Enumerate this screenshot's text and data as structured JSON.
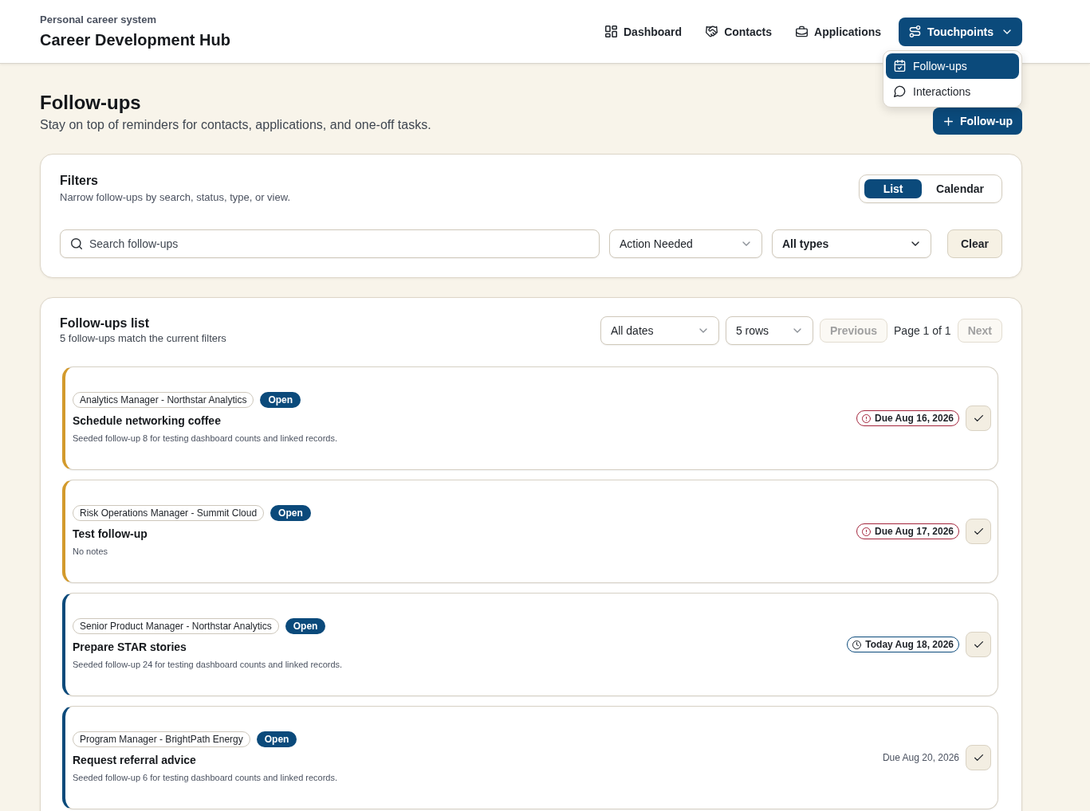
{
  "header": {
    "eyebrow": "Personal career system",
    "title": "Career Development Hub"
  },
  "nav": [
    {
      "label": "Dashboard",
      "kind": "link",
      "selected": false
    },
    {
      "label": "Contacts",
      "kind": "link",
      "selected": false
    },
    {
      "label": "Applications",
      "kind": "link",
      "selected": false
    },
    {
      "label": "Touchpoints",
      "kind": "menu",
      "selected": true,
      "expanded": true,
      "menu": [
        {
          "label": "Follow-ups",
          "selected": true
        },
        {
          "label": "Interactions",
          "selected": false
        }
      ]
    }
  ],
  "page": {
    "title": "Follow-ups",
    "subtitle": "Stay on top of reminders for contacts, applications, and one-off tasks.",
    "add_button": "Follow-up"
  },
  "filters": {
    "title": "Filters",
    "description": "Narrow follow-ups by search, status, type, or view.",
    "view_toggle": [
      {
        "label": "List",
        "selected": true
      },
      {
        "label": "Calendar",
        "selected": false
      }
    ],
    "search": {
      "placeholder": "Search follow-ups"
    },
    "status_select": {
      "value": "Action Needed"
    },
    "type_select": {
      "value": "All types"
    },
    "clear_button": "Clear"
  },
  "list": {
    "title": "Follow-ups list",
    "summary": "5 follow-ups match the current filters",
    "date_select": {
      "value": "All dates"
    },
    "rows_select": {
      "value": "5 rows"
    },
    "pagination": {
      "previous": {
        "label": "Previous",
        "disabled": true
      },
      "page_label": "Page 1 of 1",
      "next": {
        "label": "Next",
        "disabled": true
      }
    },
    "items": [
      {
        "color": "#d39a2c",
        "context": "Analytics Manager - Northstar Analytics",
        "status": "Open",
        "title": "Schedule networking coffee",
        "notes": "Seeded follow-up 8 for testing dashboard counts and linked records.",
        "due": {
          "kind": "overdue",
          "text": "Due Aug 16, 2026"
        }
      },
      {
        "color": "#d39a2c",
        "context": "Risk Operations Manager - Summit Cloud",
        "status": "Open",
        "title": "Test follow-up",
        "notes": "No notes",
        "due": {
          "kind": "overdue",
          "text": "Due Aug 17, 2026"
        }
      },
      {
        "color": "#0b4a7b",
        "context": "Senior Product Manager - Northstar Analytics",
        "status": "Open",
        "title": "Prepare STAR stories",
        "notes": "Seeded follow-up 24 for testing dashboard counts and linked records.",
        "due": {
          "kind": "today",
          "text": "Today Aug 18, 2026"
        }
      },
      {
        "color": "#0b4a7b",
        "context": "Program Manager - BrightPath Energy",
        "status": "Open",
        "title": "Request referral advice",
        "notes": "Seeded follow-up 6 for testing dashboard counts and linked records.",
        "due": {
          "kind": "plain",
          "text": "Due Aug 20, 2026"
        }
      }
    ]
  }
}
